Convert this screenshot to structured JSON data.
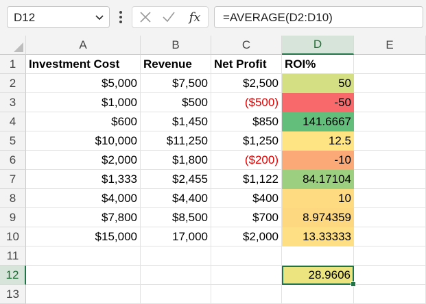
{
  "formula_bar": {
    "name_box": "D12",
    "formula": "=AVERAGE(D2:D10)"
  },
  "icons": {
    "name_box_dropdown": "chevron-down-icon",
    "more": "kebab-icon",
    "cancel": "close-icon",
    "enter": "check-icon",
    "insert_function": "fx-icon"
  },
  "fx_label": "fx",
  "colors": {
    "selection": "#217346",
    "negative_text": "#e00000",
    "roi_50": "#d4de82",
    "roi_neg50": "#f8696b",
    "roi_141": "#63be7b",
    "roi_12_5": "#ffe484",
    "roi_neg10": "#fbaa77",
    "roi_84": "#9dcf80",
    "roi_10": "#fedb81",
    "roi_8_97": "#fed881",
    "roi_13": "#fedf83",
    "avg": "#ebe47f"
  },
  "columns": [
    "A",
    "B",
    "C",
    "D",
    "E"
  ],
  "rows": [
    "1",
    "2",
    "3",
    "4",
    "5",
    "6",
    "7",
    "8",
    "9",
    "10",
    "11",
    "12",
    "13"
  ],
  "table": {
    "headers": [
      "Investment Cost",
      "Revenue",
      "Net Profit",
      "ROI%"
    ],
    "data": [
      [
        "$5,000",
        "$7,500",
        "$2,500",
        "50"
      ],
      [
        "$1,000",
        "$500",
        "($500)",
        "-50"
      ],
      [
        "$600",
        "$1,450",
        "$850",
        "141.6667"
      ],
      [
        "$10,000",
        "$11,250",
        "$1,250",
        "12.5"
      ],
      [
        "$2,000",
        "$1,800",
        "($200)",
        "-10"
      ],
      [
        "$1,333",
        "$2,455",
        "$1,122",
        "84.17104"
      ],
      [
        "$4,000",
        "$4,400",
        "$400",
        "10"
      ],
      [
        "$7,800",
        "$8,500",
        "$700",
        "8.974359"
      ],
      [
        "$15,000",
        "17,000",
        "$2,000",
        "13.33333"
      ]
    ],
    "average_cell": "28.9606"
  }
}
